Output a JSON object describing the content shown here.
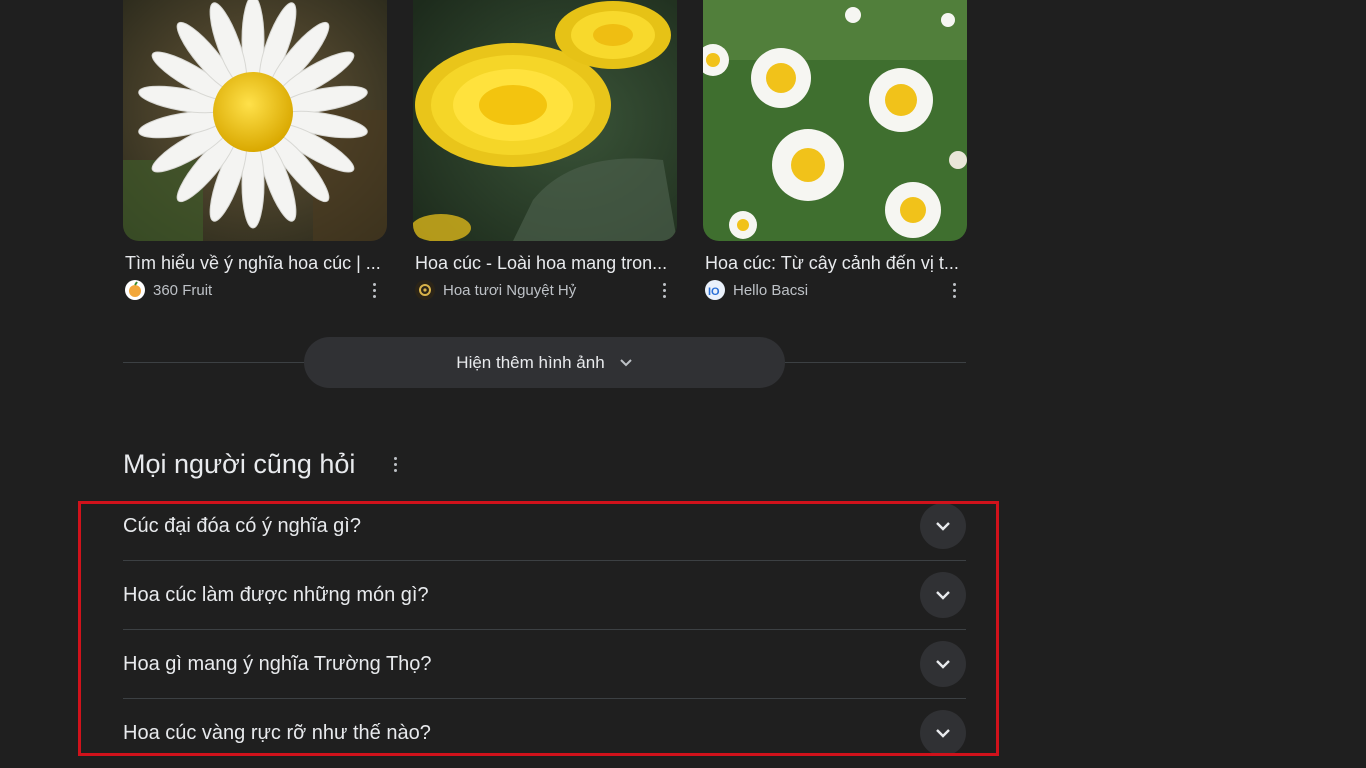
{
  "image_results": [
    {
      "title": "Tìm hiểu về ý nghĩa hoa cúc | ...",
      "source": "360 Fruit",
      "image_icon": "white-daisy-photo",
      "logo_icon": "fruit-logo-icon"
    },
    {
      "title": "Hoa cúc - Loài hoa mang tron...",
      "source": "Hoa tươi Nguyệt Hỷ",
      "image_icon": "yellow-chrysanthemum-photo",
      "logo_icon": "flower-shop-logo-icon"
    },
    {
      "title": "Hoa cúc: Từ cây cảnh đến vị t...",
      "source": "Hello Bacsi",
      "image_icon": "daisy-field-photo",
      "logo_icon": "hellobacsi-logo-icon"
    }
  ],
  "show_more": {
    "label": "Hiện thêm hình ảnh"
  },
  "people_also_ask": {
    "title": "Mọi người cũng hỏi",
    "questions": [
      "Cúc đại đóa có ý nghĩa gì?",
      "Hoa cúc làm được những món gì?",
      "Hoa gì mang ý nghĩa Trường Thọ?",
      "Hoa cúc vàng rực rỡ như thế nào?"
    ]
  },
  "colors": {
    "background": "#1f1f1f",
    "text": "#e8eaed",
    "secondary_text": "#bdc1c6",
    "button_bg": "#303134",
    "highlight_border": "#d0121b"
  }
}
